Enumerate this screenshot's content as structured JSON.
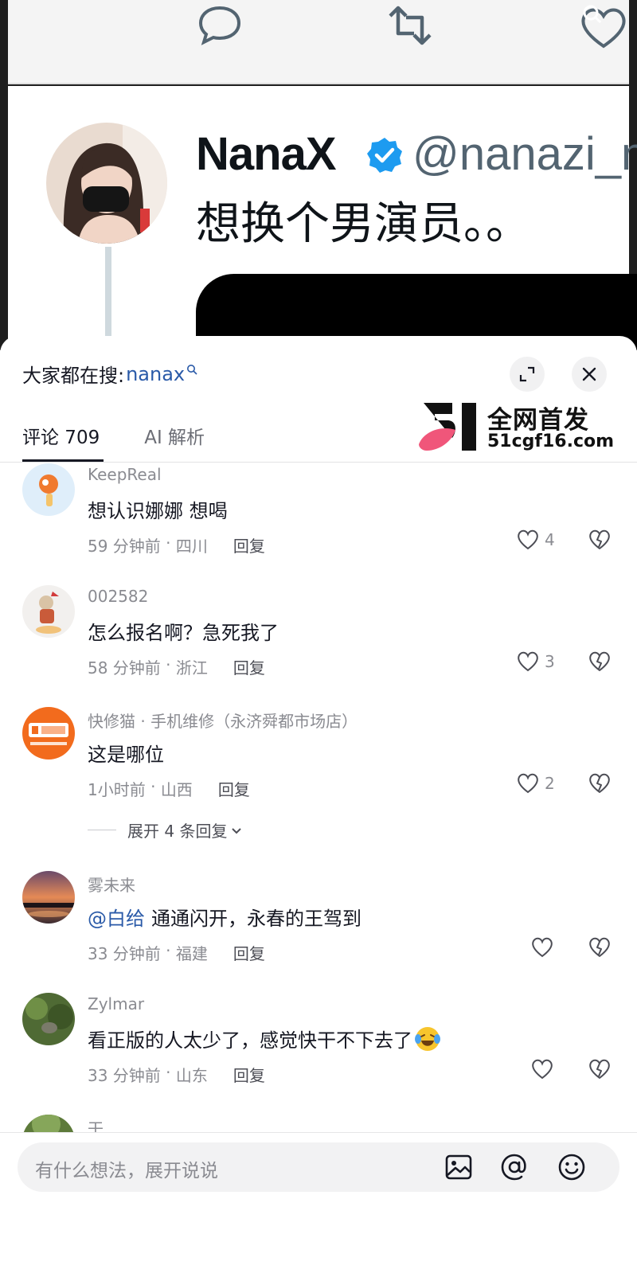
{
  "background_post": {
    "author_name": "NanaX",
    "author_handle": "@nanazi_n",
    "text": "想换个男演员。。"
  },
  "sheet": {
    "search_label": "大家都在搜:",
    "search_keyword": "nanax",
    "tabs": [
      {
        "label": "评论 709",
        "active": true
      },
      {
        "label": "AI 解析",
        "active": false
      }
    ],
    "watermark": {
      "line1": "全网首发",
      "line2": "51cgf16.com"
    }
  },
  "comments": [
    {
      "user": "KeepReal",
      "text": "想认识娜娜 想喝",
      "time": "59 分钟前",
      "location": "四川",
      "reply_label": "回复",
      "likes": "4"
    },
    {
      "user": "002582",
      "text": "怎么报名啊？急死我了",
      "time": "58 分钟前",
      "location": "浙江",
      "reply_label": "回复",
      "likes": "3"
    },
    {
      "user": "快修猫 · 手机维修（永济舜都市场店）",
      "text": "这是哪位",
      "time": "1小时前",
      "location": "山西",
      "reply_label": "回复",
      "likes": "2",
      "expand_label": "展开 4 条回复"
    },
    {
      "user": "雾未来",
      "mention": "@白给",
      "text": "通通闪开，永春的王驾到",
      "time": "33 分钟前",
      "location": "福建",
      "reply_label": "回复",
      "likes": ""
    },
    {
      "user": "Zylmar",
      "text": "看正版的人太少了，感觉快干不下去了",
      "time": "33 分钟前",
      "location": "山东",
      "reply_label": "回复",
      "likes": ""
    },
    {
      "user": "干"
    }
  ],
  "input": {
    "placeholder": "有什么想法，展开说说"
  },
  "colors": {
    "link_blue": "#2a5aa8",
    "verified_blue": "#1d9bf0",
    "meta_gray": "#8a8b91"
  }
}
